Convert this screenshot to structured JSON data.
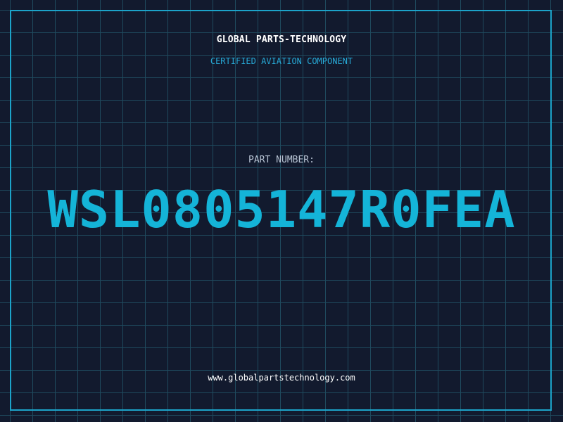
{
  "header": {
    "company": "GLOBAL PARTS-TECHNOLOGY",
    "subtitle": "CERTIFIED AVIATION COMPONENT"
  },
  "part": {
    "label": "PART NUMBER:",
    "number": "WSL0805147R0FEA"
  },
  "footer": {
    "url": "www.globalpartstechnology.com"
  },
  "colors": {
    "background": "#121a2e",
    "grid": "#1f4a5e",
    "frame": "#1ca3c9",
    "accent": "#14b4d8"
  }
}
